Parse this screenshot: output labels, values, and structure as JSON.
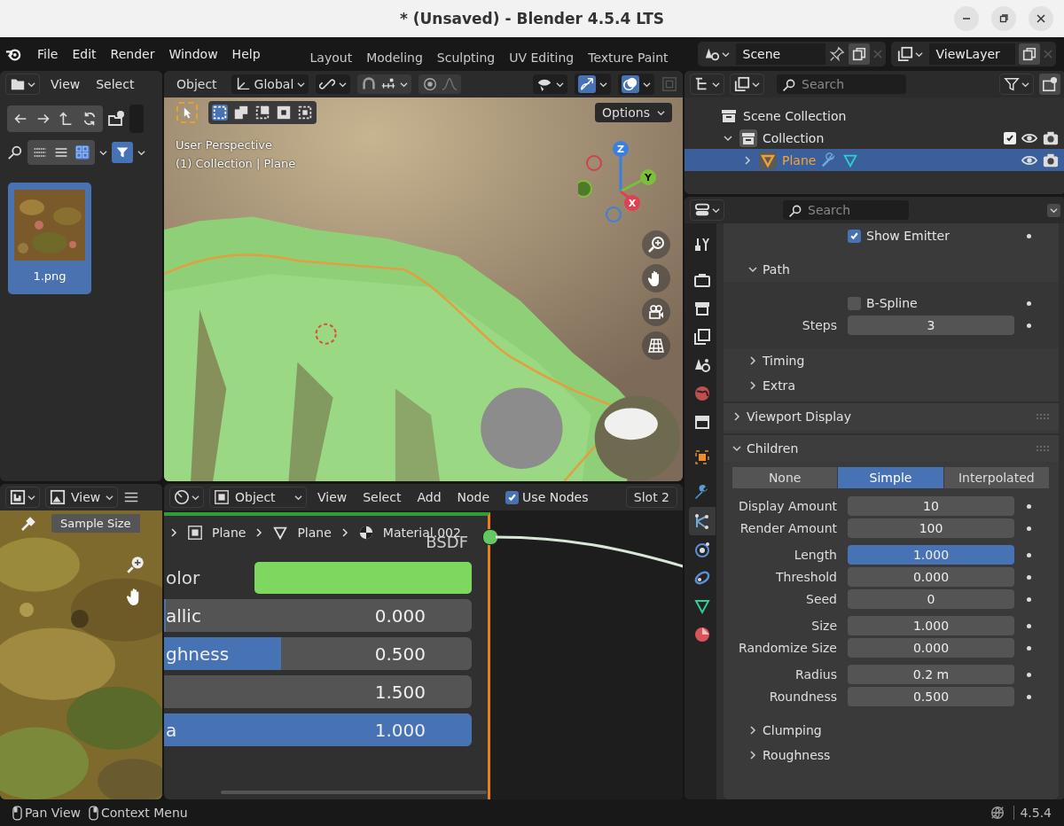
{
  "window": {
    "title": "* (Unsaved) - Blender 4.5.4 LTS"
  },
  "menu": [
    "File",
    "Edit",
    "Render",
    "Window",
    "Help"
  ],
  "workspaces": [
    {
      "label": "Layout",
      "selected": false
    },
    {
      "label": "Modeling",
      "selected": false
    },
    {
      "label": "Sculpting",
      "selected": false
    },
    {
      "label": "UV Editing",
      "selected": false
    },
    {
      "label": "Texture Paint",
      "selected": false
    }
  ],
  "scene": {
    "name": "Scene"
  },
  "view_layer": {
    "name": "ViewLayer"
  },
  "file_browser": {
    "menu": [
      "View",
      "Select"
    ],
    "files": [
      {
        "name": "1.png",
        "selected": true
      }
    ]
  },
  "viewport": {
    "mode": "Object",
    "orientation": "Global",
    "options": "Options",
    "overlay_lines": [
      "User Perspective",
      "(1) Collection | Plane"
    ],
    "axes": [
      "Z",
      "Y",
      "X"
    ]
  },
  "image_editor": {
    "menu": "View",
    "tool": "Sample Size"
  },
  "node_editor": {
    "mode": "Object",
    "menu": [
      "View",
      "Select",
      "Add",
      "Node"
    ],
    "use_nodes": {
      "label": "Use Nodes",
      "checked": true
    },
    "slot": "Slot 2",
    "breadcrumbs": [
      {
        "label": "Plane",
        "kind": "object"
      },
      {
        "label": "Plane",
        "kind": "mesh"
      },
      {
        "label": "Material.002",
        "kind": "material"
      }
    ],
    "node": {
      "title": "BSDF",
      "rows": [
        {
          "kind": "color",
          "label": "olor",
          "color": "#7ed85f"
        },
        {
          "kind": "slider",
          "label": "allic",
          "value": "0.000",
          "level": 0
        },
        {
          "kind": "slider",
          "label": "ghness",
          "value": "0.500",
          "level": 0.38
        },
        {
          "kind": "number",
          "value": "1.500"
        },
        {
          "kind": "slider",
          "label": "a",
          "value": "1.000",
          "level": 1
        }
      ]
    }
  },
  "outliner": {
    "search_placeholder": "Search",
    "items": [
      {
        "label": "Scene Collection",
        "kind": "scene_collection",
        "selected": false,
        "children": [
          {
            "label": "Collection",
            "kind": "collection",
            "expanded": true,
            "checked": true,
            "selected": false,
            "children": [
              {
                "label": "Plane",
                "kind": "mesh_object",
                "expanded": false,
                "selected": true
              }
            ]
          }
        ]
      }
    ]
  },
  "properties": {
    "search_placeholder": "Search",
    "tabs": [
      {
        "kind": "tool",
        "selected": false
      },
      {
        "kind": "render",
        "selected": false
      },
      {
        "kind": "output",
        "selected": false
      },
      {
        "kind": "view_layer",
        "selected": false
      },
      {
        "kind": "scene",
        "selected": false
      },
      {
        "kind": "world",
        "selected": false
      },
      {
        "kind": "collection",
        "selected": false
      },
      {
        "kind": "object",
        "selected": false
      },
      {
        "kind": "modifier",
        "selected": false
      },
      {
        "kind": "particles",
        "selected": true
      },
      {
        "kind": "physics",
        "selected": false
      },
      {
        "kind": "constraints",
        "selected": false
      },
      {
        "kind": "data",
        "selected": false
      },
      {
        "kind": "material",
        "selected": false
      }
    ],
    "sections": [
      {
        "kind": "fields",
        "groups": [
          [
            {
              "kind": "checkbox",
              "label": "Show Emitter",
              "checked": true
            }
          ]
        ]
      },
      {
        "kind": "subpanel",
        "title": "Path",
        "expanded": true,
        "groups": [
          [
            {
              "kind": "checkbox",
              "label": "B-Spline",
              "checked": false
            },
            {
              "kind": "number",
              "label": "Steps",
              "value": "3",
              "selected": false
            }
          ]
        ]
      },
      {
        "kind": "subpanel",
        "title": "Timing",
        "expanded": false
      },
      {
        "kind": "subpanel",
        "title": "Extra",
        "expanded": false
      },
      {
        "kind": "panel",
        "title": "Viewport Display",
        "expanded": false
      },
      {
        "kind": "panel",
        "title": "Children",
        "expanded": true,
        "groups": [
          [
            {
              "kind": "segmented",
              "options": [
                {
                  "label": "None",
                  "selected": false
                },
                {
                  "label": "Simple",
                  "selected": true
                },
                {
                  "label": "Interpolated",
                  "selected": false
                }
              ]
            }
          ],
          [
            {
              "kind": "number",
              "label": "Display Amount",
              "value": "10",
              "selected": false
            },
            {
              "kind": "number",
              "label": "Render Amount",
              "value": "100",
              "selected": false
            }
          ],
          [
            {
              "kind": "number",
              "label": "Length",
              "value": "1.000",
              "selected": true
            },
            {
              "kind": "number",
              "label": "Threshold",
              "value": "0.000",
              "selected": false
            },
            {
              "kind": "number",
              "label": "Seed",
              "value": "0",
              "selected": false
            }
          ],
          [
            {
              "kind": "number",
              "label": "Size",
              "value": "1.000",
              "selected": false
            },
            {
              "kind": "number",
              "label": "Randomize Size",
              "value": "0.000",
              "selected": false
            }
          ],
          [
            {
              "kind": "number",
              "label": "Radius",
              "value": "0.2 m",
              "selected": false
            },
            {
              "kind": "number",
              "label": "Roundness",
              "value": "0.500",
              "selected": false
            }
          ]
        ]
      },
      {
        "kind": "subpanel",
        "title": "Clumping",
        "expanded": false
      },
      {
        "kind": "subpanel",
        "title": "Roughness",
        "expanded": false
      }
    ]
  },
  "status_bar": {
    "hints": [
      "Pan View",
      "Context Menu"
    ],
    "version": "4.5.4"
  }
}
